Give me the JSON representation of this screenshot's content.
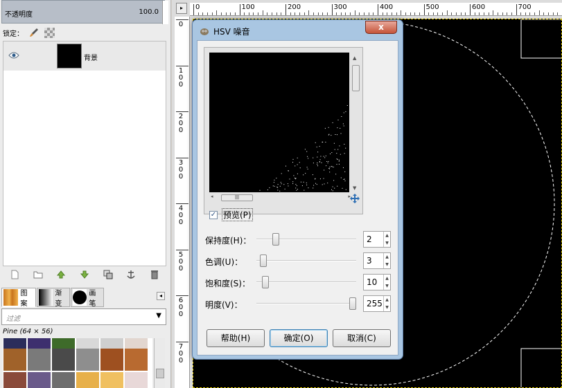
{
  "layers_panel": {
    "opacity_label": "不透明度",
    "opacity_value": "100.0",
    "lock_label": "锁定：",
    "layer_name": "背景"
  },
  "resource_tabs": [
    {
      "label": "图案"
    },
    {
      "label": "渐变"
    },
    {
      "label": "画笔"
    }
  ],
  "filter_placeholder": "过滤",
  "pattern_info": "Pine (64 × 56)",
  "rulers": {
    "h_ticks": [
      "0",
      "100",
      "200",
      "300",
      "400",
      "500",
      "600",
      "700"
    ],
    "v_ticks": [
      "0",
      "100",
      "200",
      "300",
      "400",
      "500",
      "600",
      "700"
    ]
  },
  "dialog": {
    "title": "HSV 噪音",
    "close": "x",
    "preview_label": "预览(P)",
    "preview_checked": true,
    "sliders": [
      {
        "label": "保持度(H)：",
        "value": "2",
        "fraction": 0.17
      },
      {
        "label": "色调(U)：",
        "value": "3",
        "fraction": 0.04
      },
      {
        "label": "饱和度(S)：",
        "value": "10",
        "fraction": 0.06
      },
      {
        "label": "明度(V)：",
        "value": "255",
        "fraction": 1.0
      }
    ],
    "buttons": {
      "help": "帮助(H)",
      "ok": "确定(O)",
      "cancel": "取消(C)"
    }
  }
}
